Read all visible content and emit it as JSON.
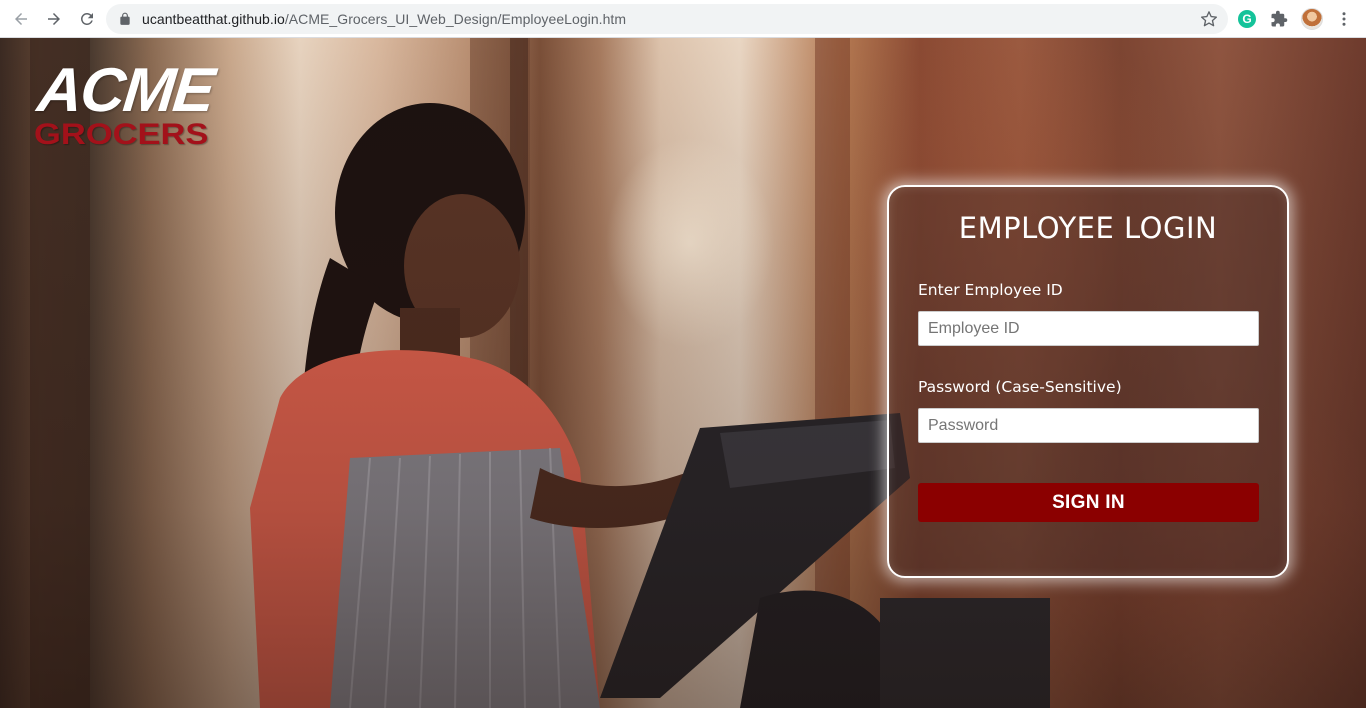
{
  "browser": {
    "url_domain": "ucantbeatthat.github.io",
    "url_path": "/ACME_Grocers_UI_Web_Design/EmployeeLogin.htm",
    "extension_grammarly_letter": "G",
    "icons": [
      "back-arrow-icon",
      "forward-arrow-icon",
      "reload-icon",
      "lock-icon",
      "star-icon",
      "grammarly-icon",
      "puzzle-icon",
      "avatar",
      "kebab-menu-icon"
    ]
  },
  "logo": {
    "line1": "ACME",
    "line2": "GROCERS"
  },
  "login": {
    "title": "EMPLOYEE LOGIN",
    "employee_id_label": "Enter Employee ID",
    "employee_id_placeholder": "Employee ID",
    "password_label": "Password (Case-Sensitive)",
    "password_placeholder": "Password",
    "sign_in_label": "SIGN IN"
  },
  "colors": {
    "sign_in_button": "#8b0000",
    "logo_red": "#a3111a",
    "card_border": "#ffffff"
  }
}
